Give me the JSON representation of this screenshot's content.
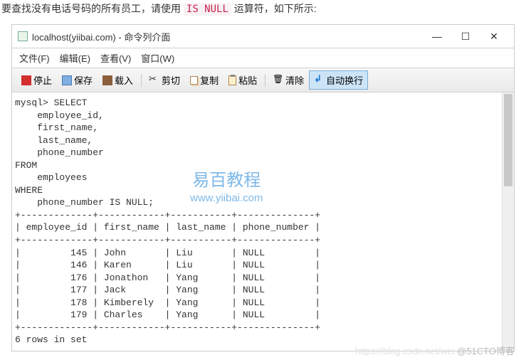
{
  "intro": {
    "pre": "要查找没有电话号码的所有员工，请使用 ",
    "code": "IS NULL",
    "post": " 运算符，如下所示:"
  },
  "titlebar": {
    "title": "localhost(yiibai.com) - 命令列介面"
  },
  "win": {
    "min": "—",
    "max": "☐",
    "close": "✕"
  },
  "menubar": {
    "file": "文件(F)",
    "edit": "编辑(E)",
    "view": "查看(V)",
    "window": "窗口(W)"
  },
  "toolbar": {
    "stop": "停止",
    "save": "保存",
    "load": "载入",
    "cut": "剪切",
    "copy": "复制",
    "paste": "粘贴",
    "clear": "清除",
    "wrap": "自动换行"
  },
  "terminal": {
    "lines": [
      "mysql> SELECT ",
      "    employee_id, ",
      "    first_name, ",
      "    last_name, ",
      "    phone_number",
      "FROM",
      "    employees",
      "WHERE",
      "    phone_number IS NULL;",
      "+-------------+------------+-----------+--------------+",
      "| employee_id | first_name | last_name | phone_number |",
      "+-------------+------------+-----------+--------------+",
      "|         145 | John       | Liu       | NULL         |",
      "|         146 | Karen      | Liu       | NULL         |",
      "|         176 | Jonathon   | Yang      | NULL         |",
      "|         177 | Jack       | Yang      | NULL         |",
      "|         178 | Kimberely  | Yang      | NULL         |",
      "|         179 | Charles    | Yang      | NULL         |",
      "+-------------+------------+-----------+--------------+",
      "6 rows in set"
    ]
  },
  "chart_data": {
    "type": "table",
    "title": "employees where phone_number IS NULL",
    "columns": [
      "employee_id",
      "first_name",
      "last_name",
      "phone_number"
    ],
    "rows": [
      [
        145,
        "John",
        "Liu",
        null
      ],
      [
        146,
        "Karen",
        "Liu",
        null
      ],
      [
        176,
        "Jonathon",
        "Yang",
        null
      ],
      [
        177,
        "Jack",
        "Yang",
        null
      ],
      [
        178,
        "Kimberely",
        "Yang",
        null
      ],
      [
        179,
        "Charles",
        "Yang",
        null
      ]
    ],
    "row_count": 6
  },
  "watermark": {
    "line1": "易百教程",
    "line2": "www.yiibai.com"
  },
  "footer": {
    "faint": "https://blog.csdn.net/wei ",
    "brand": "@51CTO博客"
  }
}
